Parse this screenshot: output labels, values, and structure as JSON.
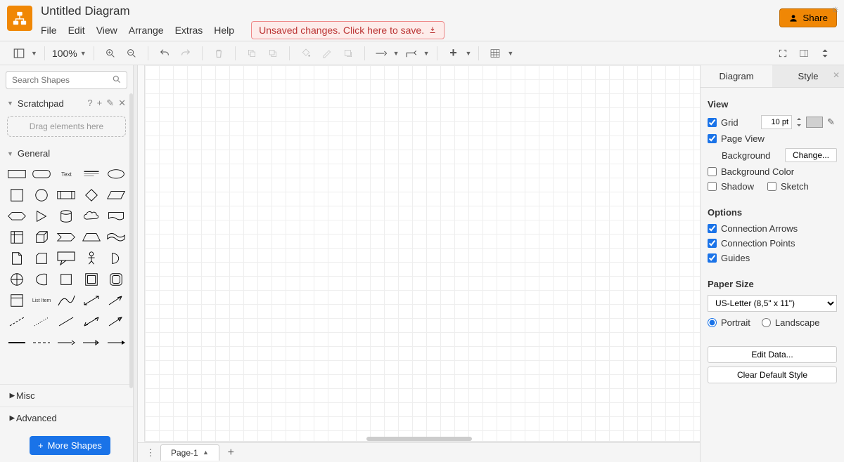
{
  "header": {
    "doc_title": "Untitled Diagram",
    "menus": [
      "File",
      "Edit",
      "View",
      "Arrange",
      "Extras",
      "Help"
    ],
    "unsaved_text": "Unsaved changes. Click here to save.",
    "share_label": "Share"
  },
  "toolbar": {
    "zoom": "100%"
  },
  "left_sidebar": {
    "search_placeholder": "Search Shapes",
    "scratchpad_label": "Scratchpad",
    "scratchpad_drop": "Drag elements here",
    "general_label": "General",
    "misc_label": "Misc",
    "advanced_label": "Advanced",
    "more_shapes_label": "More Shapes"
  },
  "pages": {
    "tab_label": "Page-1"
  },
  "right_sidebar": {
    "tabs": {
      "diagram": "Diagram",
      "style": "Style"
    },
    "view_section": "View",
    "grid_label": "Grid",
    "grid_size": "10 pt",
    "page_view_label": "Page View",
    "background_label": "Background",
    "change_btn": "Change...",
    "bg_color_label": "Background Color",
    "shadow_label": "Shadow",
    "sketch_label": "Sketch",
    "options_section": "Options",
    "conn_arrows": "Connection Arrows",
    "conn_points": "Connection Points",
    "guides": "Guides",
    "paper_section": "Paper Size",
    "paper_value": "US-Letter (8,5\" x 11\")",
    "portrait": "Portrait",
    "landscape": "Landscape",
    "edit_data": "Edit Data...",
    "clear_style": "Clear Default Style"
  }
}
